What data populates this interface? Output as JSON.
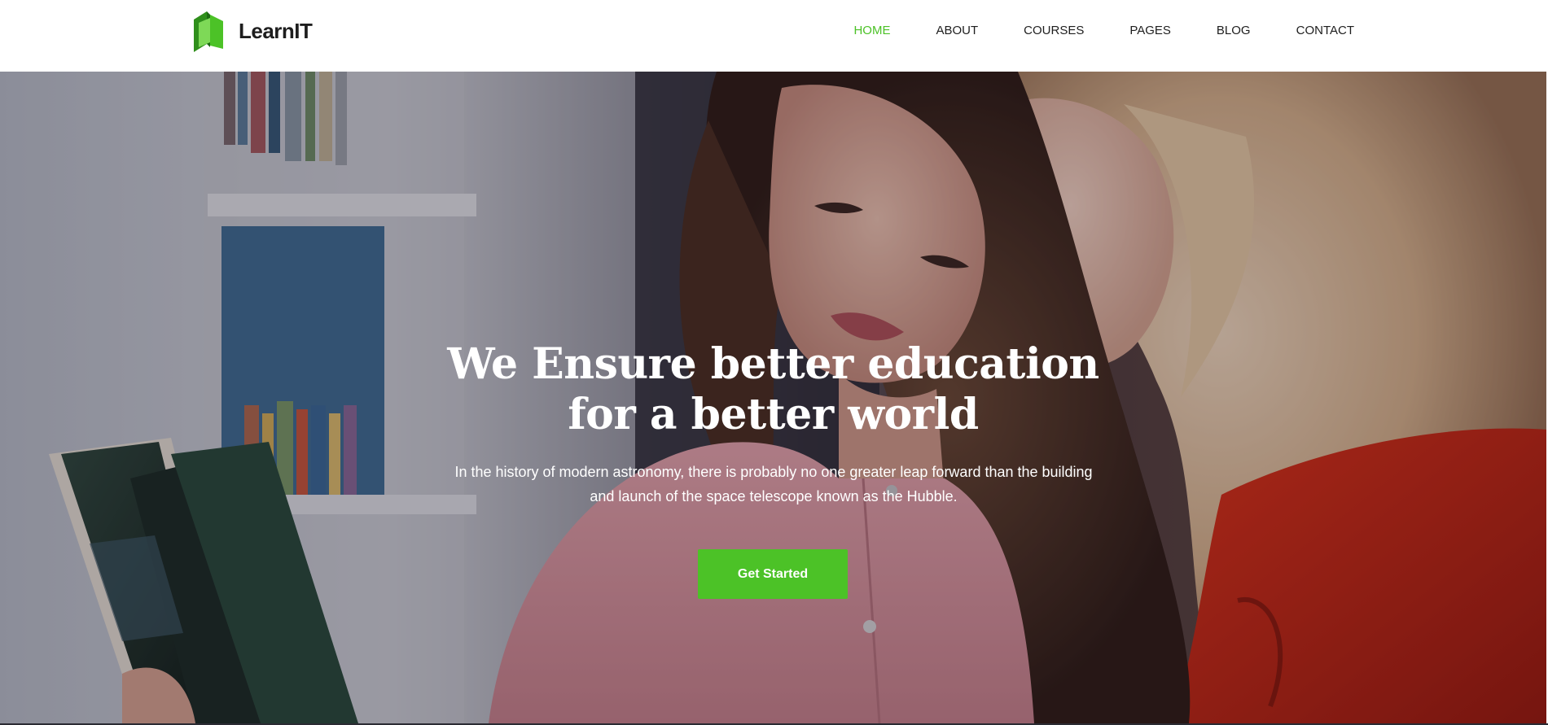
{
  "brand": {
    "name": "LearnIT",
    "icon": "book-logo-icon",
    "logo_colors": [
      "#4cc227",
      "#7ed957",
      "#2f8f1b"
    ]
  },
  "nav": {
    "items": [
      {
        "label": "HOME",
        "active": true
      },
      {
        "label": "ABOUT",
        "active": false
      },
      {
        "label": "COURSES",
        "active": false
      },
      {
        "label": "PAGES",
        "active": false
      },
      {
        "label": "BLOG",
        "active": false
      },
      {
        "label": "CONTACT",
        "active": false
      }
    ]
  },
  "hero": {
    "title_line1": "We Ensure better education",
    "title_line2": "for a better world",
    "description": "In the history of modern astronomy, there is probably no one greater leap forward than the building and launch of the space telescope known as the Hubble.",
    "cta_label": "Get Started"
  },
  "colors": {
    "accent": "#4cc227",
    "nav_text": "#1e1e1e",
    "header_bg": "#ffffff",
    "hero_text": "#ffffff"
  }
}
